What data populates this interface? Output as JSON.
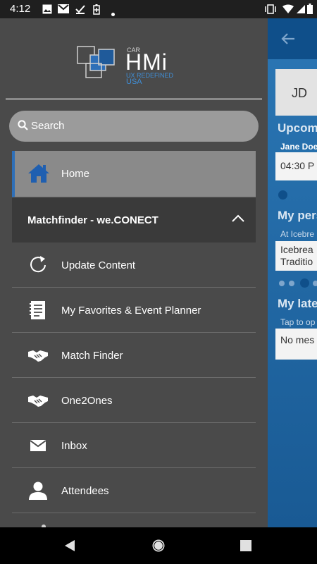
{
  "status_bar": {
    "time": "4:12",
    "notification_icons": [
      "image-icon",
      "gmail-icon",
      "download-done-icon",
      "battery-saver-icon",
      "dot-icon"
    ],
    "system_icons": [
      "vibrate-icon",
      "wifi-icon",
      "signal-icon",
      "battery-icon"
    ]
  },
  "drawer": {
    "logo": {
      "car": "CAR",
      "hmi": "HMi",
      "tagline": "UX REDEFINED",
      "region": "USA"
    },
    "search": {
      "label": "Search"
    },
    "home": {
      "label": "Home",
      "icon": "home-icon"
    },
    "section": {
      "title": "Matchfinder - we.CONECT",
      "icon": "chevron-up-icon"
    },
    "items": [
      {
        "label": "Update Content",
        "icon": "refresh-icon"
      },
      {
        "label": "My Favorites & Event Planner",
        "icon": "planner-icon"
      },
      {
        "label": "Match Finder",
        "icon": "handshake-icon"
      },
      {
        "label": "One2Ones",
        "icon": "handshake-icon"
      },
      {
        "label": "Inbox",
        "icon": "mail-icon"
      },
      {
        "label": "Attendees",
        "icon": "person-icon"
      }
    ]
  },
  "background": {
    "avatar_initials": "JD",
    "upcoming_heading": "Upcom",
    "upcoming_name": "Jane Doe",
    "upcoming_time": "04:30 P",
    "personal_heading": "My pers",
    "personal_sub": "At Icebre",
    "personal_card_line1": "Icebrea",
    "personal_card_line2": "Traditio",
    "latest_heading": "My late",
    "latest_sub": "Tap to op",
    "latest_card": "No mes"
  },
  "colors": {
    "drawer_bg": "#4a4a4a",
    "accent_blue": "#2e6fb8",
    "app_blue": "#2b77b5"
  },
  "nav": {
    "buttons": [
      "back-nav-icon",
      "home-nav-icon",
      "recents-nav-icon"
    ]
  }
}
